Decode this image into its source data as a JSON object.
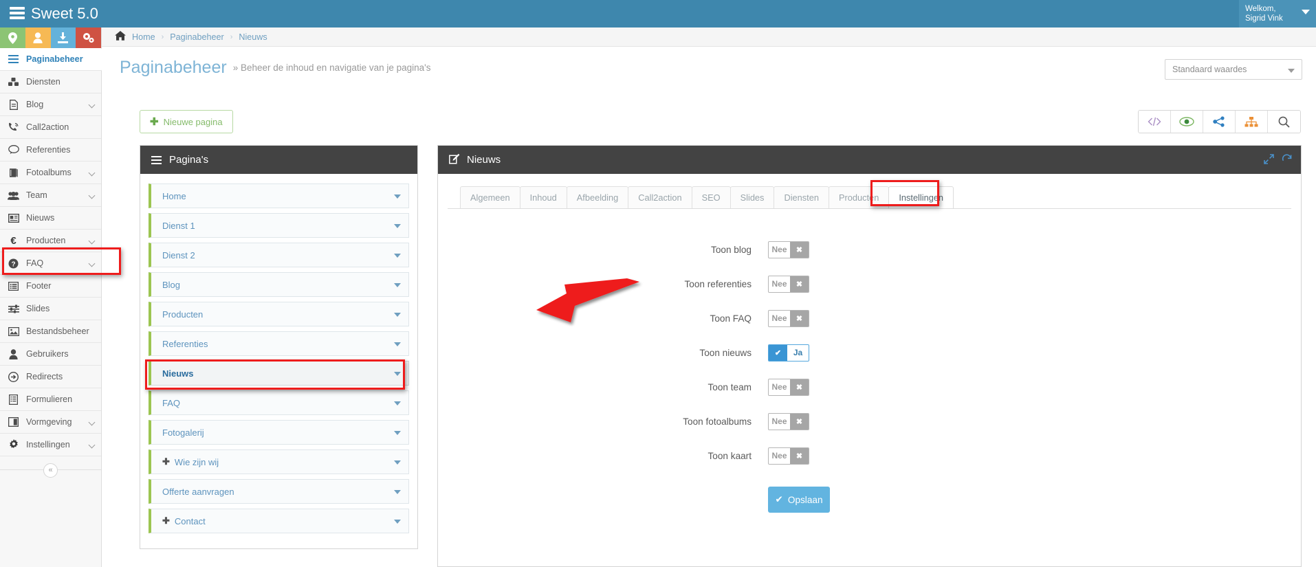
{
  "app": {
    "brand": "Sweet 5.0",
    "brand_icon": "server-stack-icon",
    "user_greeting": "Welkom,",
    "user_name": "Sigrid Vink"
  },
  "quick_actions": [
    {
      "name": "map-marker-icon",
      "color": "#8cc474"
    },
    {
      "name": "user-icon",
      "color": "#f6b954"
    },
    {
      "name": "download-icon",
      "color": "#64b2da"
    },
    {
      "name": "cogs-icon",
      "color": "#cf5243"
    }
  ],
  "sidebar": {
    "items": [
      {
        "label": "Paginabeheer",
        "icon": "bars-icon",
        "active": true,
        "chevron": false
      },
      {
        "label": "Diensten",
        "icon": "cubes-icon",
        "active": false,
        "chevron": false
      },
      {
        "label": "Blog",
        "icon": "file-text-icon",
        "active": false,
        "chevron": true
      },
      {
        "label": "Call2action",
        "icon": "phone-volume-icon",
        "active": false,
        "chevron": false
      },
      {
        "label": "Referenties",
        "icon": "comment-icon",
        "active": false,
        "chevron": false
      },
      {
        "label": "Fotoalbums",
        "icon": "book-icon",
        "active": false,
        "chevron": true
      },
      {
        "label": "Team",
        "icon": "users-icon",
        "active": false,
        "chevron": true
      },
      {
        "label": "Nieuws",
        "icon": "newspaper-icon",
        "active": false,
        "chevron": false
      },
      {
        "label": "Producten",
        "icon": "euro-icon",
        "active": false,
        "chevron": true
      },
      {
        "label": "FAQ",
        "icon": "question-circle-icon",
        "active": false,
        "chevron": true
      },
      {
        "label": "Footer",
        "icon": "list-icon",
        "active": false,
        "chevron": false
      },
      {
        "label": "Slides",
        "icon": "sliders-icon",
        "active": false,
        "chevron": false
      },
      {
        "label": "Bestandsbeheer",
        "icon": "image-icon",
        "active": false,
        "chevron": false
      },
      {
        "label": "Gebruikers",
        "icon": "user-icon",
        "active": false,
        "chevron": false
      },
      {
        "label": "Redirects",
        "icon": "arrow-circle-right-icon",
        "active": false,
        "chevron": false
      },
      {
        "label": "Formulieren",
        "icon": "form-icon",
        "active": false,
        "chevron": false
      },
      {
        "label": "Vormgeving",
        "icon": "columns-icon",
        "active": false,
        "chevron": true
      },
      {
        "label": "Instellingen",
        "icon": "gear-icon",
        "active": false,
        "chevron": true
      }
    ],
    "collapse_label": "«"
  },
  "breadcrumb": {
    "home": "Home",
    "sep": "›",
    "section": "Paginabeheer",
    "current": "Nieuws"
  },
  "header": {
    "title": "Paginabeheer",
    "subtitle": "» Beheer de inhoud en navigatie van je pagina's",
    "preset_select": "Standaard waardes"
  },
  "actions": {
    "new_page": "Nieuwe pagina",
    "new_page_plus": "✚",
    "tools": [
      {
        "name": "code-icon",
        "glyph": "</>"
      },
      {
        "name": "eye-icon",
        "glyph": "eye"
      },
      {
        "name": "share-icon",
        "glyph": "share"
      },
      {
        "name": "sitemap-icon",
        "glyph": "sitemap"
      },
      {
        "name": "search-icon",
        "glyph": "search"
      }
    ]
  },
  "pages_panel": {
    "title": "Pagina's",
    "rows": [
      {
        "label": "Home",
        "expandable": false,
        "selected": false
      },
      {
        "label": "Dienst 1",
        "expandable": false,
        "selected": false
      },
      {
        "label": "Dienst 2",
        "expandable": false,
        "selected": false
      },
      {
        "label": "Blog",
        "expandable": false,
        "selected": false
      },
      {
        "label": "Producten",
        "expandable": false,
        "selected": false
      },
      {
        "label": "Referenties",
        "expandable": false,
        "selected": false
      },
      {
        "label": "Nieuws",
        "expandable": false,
        "selected": true
      },
      {
        "label": "FAQ",
        "expandable": false,
        "selected": false
      },
      {
        "label": "Fotogalerij",
        "expandable": false,
        "selected": false
      },
      {
        "label": "Wie zijn wij",
        "expandable": true,
        "selected": false
      },
      {
        "label": "Offerte aanvragen",
        "expandable": false,
        "selected": false
      },
      {
        "label": "Contact",
        "expandable": true,
        "selected": false
      }
    ]
  },
  "edit_panel": {
    "title": "Nieuws",
    "title_icon": "pencil-square-icon",
    "expand_icon": "expand-icon",
    "refresh_icon": "refresh-icon",
    "tabs": [
      {
        "label": "Algemeen",
        "active": false
      },
      {
        "label": "Inhoud",
        "active": false
      },
      {
        "label": "Afbeelding",
        "active": false
      },
      {
        "label": "Call2action",
        "active": false
      },
      {
        "label": "SEO",
        "active": false
      },
      {
        "label": "Slides",
        "active": false
      },
      {
        "label": "Diensten",
        "active": false
      },
      {
        "label": "Producten",
        "active": false
      },
      {
        "label": "Instellingen",
        "active": true
      }
    ],
    "fields": [
      {
        "label": "Toon blog",
        "value": "Nee",
        "on": false
      },
      {
        "label": "Toon referenties",
        "value": "Nee",
        "on": false
      },
      {
        "label": "Toon FAQ",
        "value": "Nee",
        "on": false
      },
      {
        "label": "Toon nieuws",
        "value": "Ja",
        "on": true
      },
      {
        "label": "Toon team",
        "value": "Nee",
        "on": false
      },
      {
        "label": "Toon fotoalbums",
        "value": "Nee",
        "on": false
      },
      {
        "label": "Toon kaart",
        "value": "Nee",
        "on": false
      }
    ],
    "save_label": "Opslaan"
  },
  "annotations": {
    "accent_color": "#ee1c1c",
    "highlighted": [
      "sidebar-item-nieuws",
      "page-row-nieuws",
      "tab-instellingen"
    ],
    "arrow_points_to": "toon-nieuws-toggle"
  }
}
